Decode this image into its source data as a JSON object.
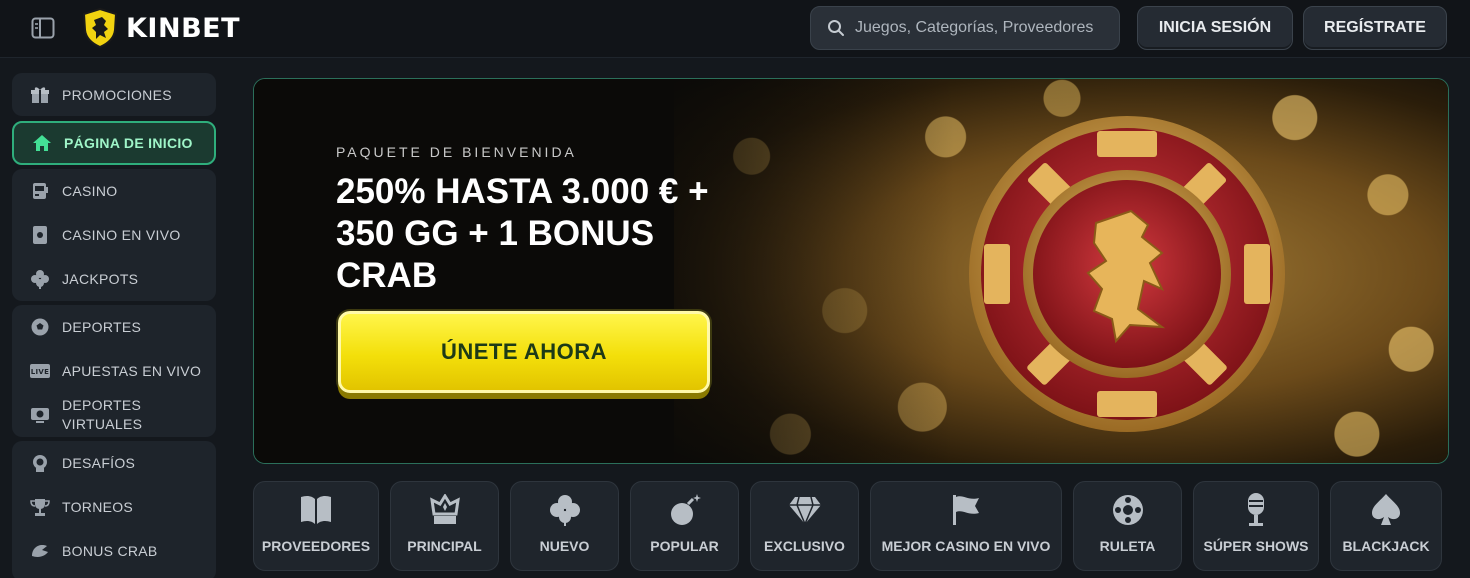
{
  "header": {
    "brand": "KINBET",
    "search_placeholder": "Juegos, Categorías, Proveedores",
    "login_label": "INICIA SESIÓN",
    "register_label": "REGÍSTRATE"
  },
  "sidebar": {
    "groups": [
      {
        "items": [
          {
            "label": "PROMOCIONES",
            "icon": "gift-icon"
          },
          {
            "label": "PÁGINA DE INICIO",
            "icon": "home-icon",
            "active": true
          }
        ]
      },
      {
        "items": [
          {
            "label": "CASINO",
            "icon": "slot-machine-icon"
          },
          {
            "label": "CASINO EN VIVO",
            "icon": "card-icon"
          },
          {
            "label": "JACKPOTS",
            "icon": "clover-icon"
          }
        ]
      },
      {
        "items": [
          {
            "label": "DEPORTES",
            "icon": "soccer-ball-icon"
          },
          {
            "label": "APUESTAS EN VIVO",
            "icon": "live-badge-icon",
            "badge": "LIVE"
          },
          {
            "label_line1": "DEPORTES",
            "label_line2": "VIRTUALES",
            "icon": "virtual-sports-icon"
          }
        ]
      },
      {
        "items": [
          {
            "label": "DESAFÍOS",
            "icon": "medal-icon"
          },
          {
            "label": "TORNEOS",
            "icon": "trophy-icon"
          },
          {
            "label": "BONUS CRAB",
            "icon": "crab-claw-icon"
          }
        ]
      }
    ]
  },
  "banner": {
    "kicker": "PAQUETE DE BIENVENIDA",
    "title": "250% HASTA 3.000 € + 350 GG + 1 BONUS CRAB",
    "cta_label": "ÚNETE AHORA"
  },
  "categories": [
    {
      "label": "PROVEEDORES",
      "icon": "book-icon"
    },
    {
      "label": "PRINCIPAL",
      "icon": "crown-icon"
    },
    {
      "label": "NUEVO",
      "icon": "clover-icon"
    },
    {
      "label": "POPULAR",
      "icon": "bomb-icon"
    },
    {
      "label": "EXCLUSIVO",
      "icon": "diamond-icon"
    },
    {
      "label": "MEJOR CASINO EN VIVO",
      "icon": "flag-icon"
    },
    {
      "label": "RULETA",
      "icon": "roulette-icon"
    },
    {
      "label": "SÚPER SHOWS",
      "icon": "microphone-icon"
    },
    {
      "label": "BLACKJACK",
      "icon": "spade-icon"
    }
  ],
  "colors": {
    "accent_green": "#2fae7c",
    "cta_yellow": "#f3df0a",
    "chip_red": "#b3222a",
    "chip_gold": "#d9a84a"
  }
}
